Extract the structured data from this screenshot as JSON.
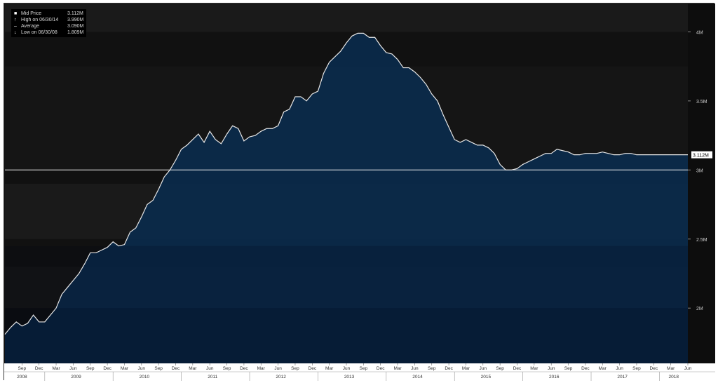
{
  "legend": {
    "rows": [
      {
        "icon": "■",
        "label": "Mid Price",
        "value": "3.112M"
      },
      {
        "icon": "↑",
        "label": "High on 06/30/14",
        "value": "3.990M"
      },
      {
        "icon": "–",
        "label": "Average",
        "value": "3.090M"
      },
      {
        "icon": "↓",
        "label": "Low on 06/30/08",
        "value": "1.809M"
      }
    ]
  },
  "chart_data": {
    "type": "area",
    "series": [
      {
        "name": "Mid Price",
        "x": [
          "2008-06",
          "2008-07",
          "2008-08",
          "2008-09",
          "2008-10",
          "2008-11",
          "2008-12",
          "2009-01",
          "2009-02",
          "2009-03",
          "2009-04",
          "2009-05",
          "2009-06",
          "2009-07",
          "2009-08",
          "2009-09",
          "2009-10",
          "2009-11",
          "2009-12",
          "2010-01",
          "2010-02",
          "2010-03",
          "2010-04",
          "2010-05",
          "2010-06",
          "2010-07",
          "2010-08",
          "2010-09",
          "2010-10",
          "2010-11",
          "2010-12",
          "2011-01",
          "2011-02",
          "2011-03",
          "2011-04",
          "2011-05",
          "2011-06",
          "2011-07",
          "2011-08",
          "2011-09",
          "2011-10",
          "2011-11",
          "2011-12",
          "2012-01",
          "2012-02",
          "2012-03",
          "2012-04",
          "2012-05",
          "2012-06",
          "2012-07",
          "2012-08",
          "2012-09",
          "2012-10",
          "2012-11",
          "2012-12",
          "2013-01",
          "2013-02",
          "2013-03",
          "2013-04",
          "2013-05",
          "2013-06",
          "2013-07",
          "2013-08",
          "2013-09",
          "2013-10",
          "2013-11",
          "2013-12",
          "2014-01",
          "2014-02",
          "2014-03",
          "2014-04",
          "2014-05",
          "2014-06",
          "2014-07",
          "2014-08",
          "2014-09",
          "2014-10",
          "2014-11",
          "2014-12",
          "2015-01",
          "2015-02",
          "2015-03",
          "2015-04",
          "2015-05",
          "2015-06",
          "2015-07",
          "2015-08",
          "2015-09",
          "2015-10",
          "2015-11",
          "2015-12",
          "2016-01",
          "2016-02",
          "2016-03",
          "2016-04",
          "2016-05",
          "2016-06",
          "2016-07",
          "2016-08",
          "2016-09",
          "2016-10",
          "2016-11",
          "2016-12",
          "2017-01",
          "2017-02",
          "2017-03",
          "2017-04",
          "2017-05",
          "2017-06",
          "2017-07",
          "2017-08",
          "2017-09",
          "2017-10",
          "2017-11",
          "2017-12",
          "2018-01",
          "2018-02",
          "2018-03",
          "2018-04",
          "2018-05",
          "2018-06"
        ],
        "values": [
          1.81,
          1.86,
          1.9,
          1.87,
          1.89,
          1.95,
          1.9,
          1.9,
          1.95,
          2.0,
          2.1,
          2.15,
          2.2,
          2.25,
          2.32,
          2.4,
          2.4,
          2.42,
          2.44,
          2.48,
          2.45,
          2.46,
          2.55,
          2.58,
          2.66,
          2.75,
          2.78,
          2.86,
          2.95,
          3.0,
          3.07,
          3.15,
          3.18,
          3.22,
          3.26,
          3.2,
          3.28,
          3.22,
          3.19,
          3.26,
          3.32,
          3.3,
          3.21,
          3.24,
          3.25,
          3.28,
          3.3,
          3.3,
          3.32,
          3.42,
          3.44,
          3.53,
          3.53,
          3.5,
          3.55,
          3.57,
          3.7,
          3.78,
          3.82,
          3.86,
          3.92,
          3.97,
          3.99,
          3.99,
          3.96,
          3.96,
          3.9,
          3.85,
          3.84,
          3.8,
          3.74,
          3.74,
          3.71,
          3.67,
          3.62,
          3.55,
          3.5,
          3.4,
          3.31,
          3.22,
          3.2,
          3.22,
          3.2,
          3.18,
          3.18,
          3.16,
          3.12,
          3.04,
          3.0,
          3.0,
          3.01,
          3.04,
          3.06,
          3.08,
          3.1,
          3.12,
          3.12,
          3.15,
          3.14,
          3.13,
          3.11,
          3.11,
          3.12,
          3.12,
          3.12,
          3.13,
          3.12,
          3.11,
          3.11,
          3.12,
          3.12,
          3.11,
          3.11,
          3.11,
          3.11,
          3.11,
          3.11,
          3.11,
          3.11,
          3.11,
          3.11
        ]
      }
    ],
    "y_ticks": [
      "2M",
      "2.5M",
      "3M",
      "3.5M",
      "4M"
    ],
    "y_tick_values": [
      2.0,
      2.5,
      3.0,
      3.5,
      4.0
    ],
    "ylim": [
      1.6,
      4.2
    ],
    "reference_line": {
      "value": 3.0
    },
    "last_value_label": "3.112M",
    "x_month_ticks": [
      "Sep",
      "Dec",
      "Mar",
      "Jun",
      "Sep",
      "Dec",
      "Mar",
      "Jun",
      "Sep",
      "Dec",
      "Mar",
      "Jun",
      "Sep",
      "Dec",
      "Mar",
      "Jun",
      "Sep",
      "Dec",
      "Mar",
      "Jun",
      "Sep",
      "Dec",
      "Mar",
      "Jun",
      "Sep",
      "Dec",
      "Mar",
      "Jun",
      "Sep",
      "Dec",
      "Mar",
      "Jun",
      "Sep",
      "Dec",
      "Mar",
      "Jun",
      "Sep",
      "Dec",
      "Mar",
      "Jun"
    ],
    "x_year_labels": [
      "2008",
      "2009",
      "2010",
      "2011",
      "2012",
      "2013",
      "2014",
      "2015",
      "2016",
      "2017",
      "2018"
    ],
    "colors": {
      "fill": "#0b2a4a",
      "line": "#e6e6e6",
      "ref": "#f0f0f0",
      "background": "#111111",
      "band": "#1c1c1c"
    }
  }
}
